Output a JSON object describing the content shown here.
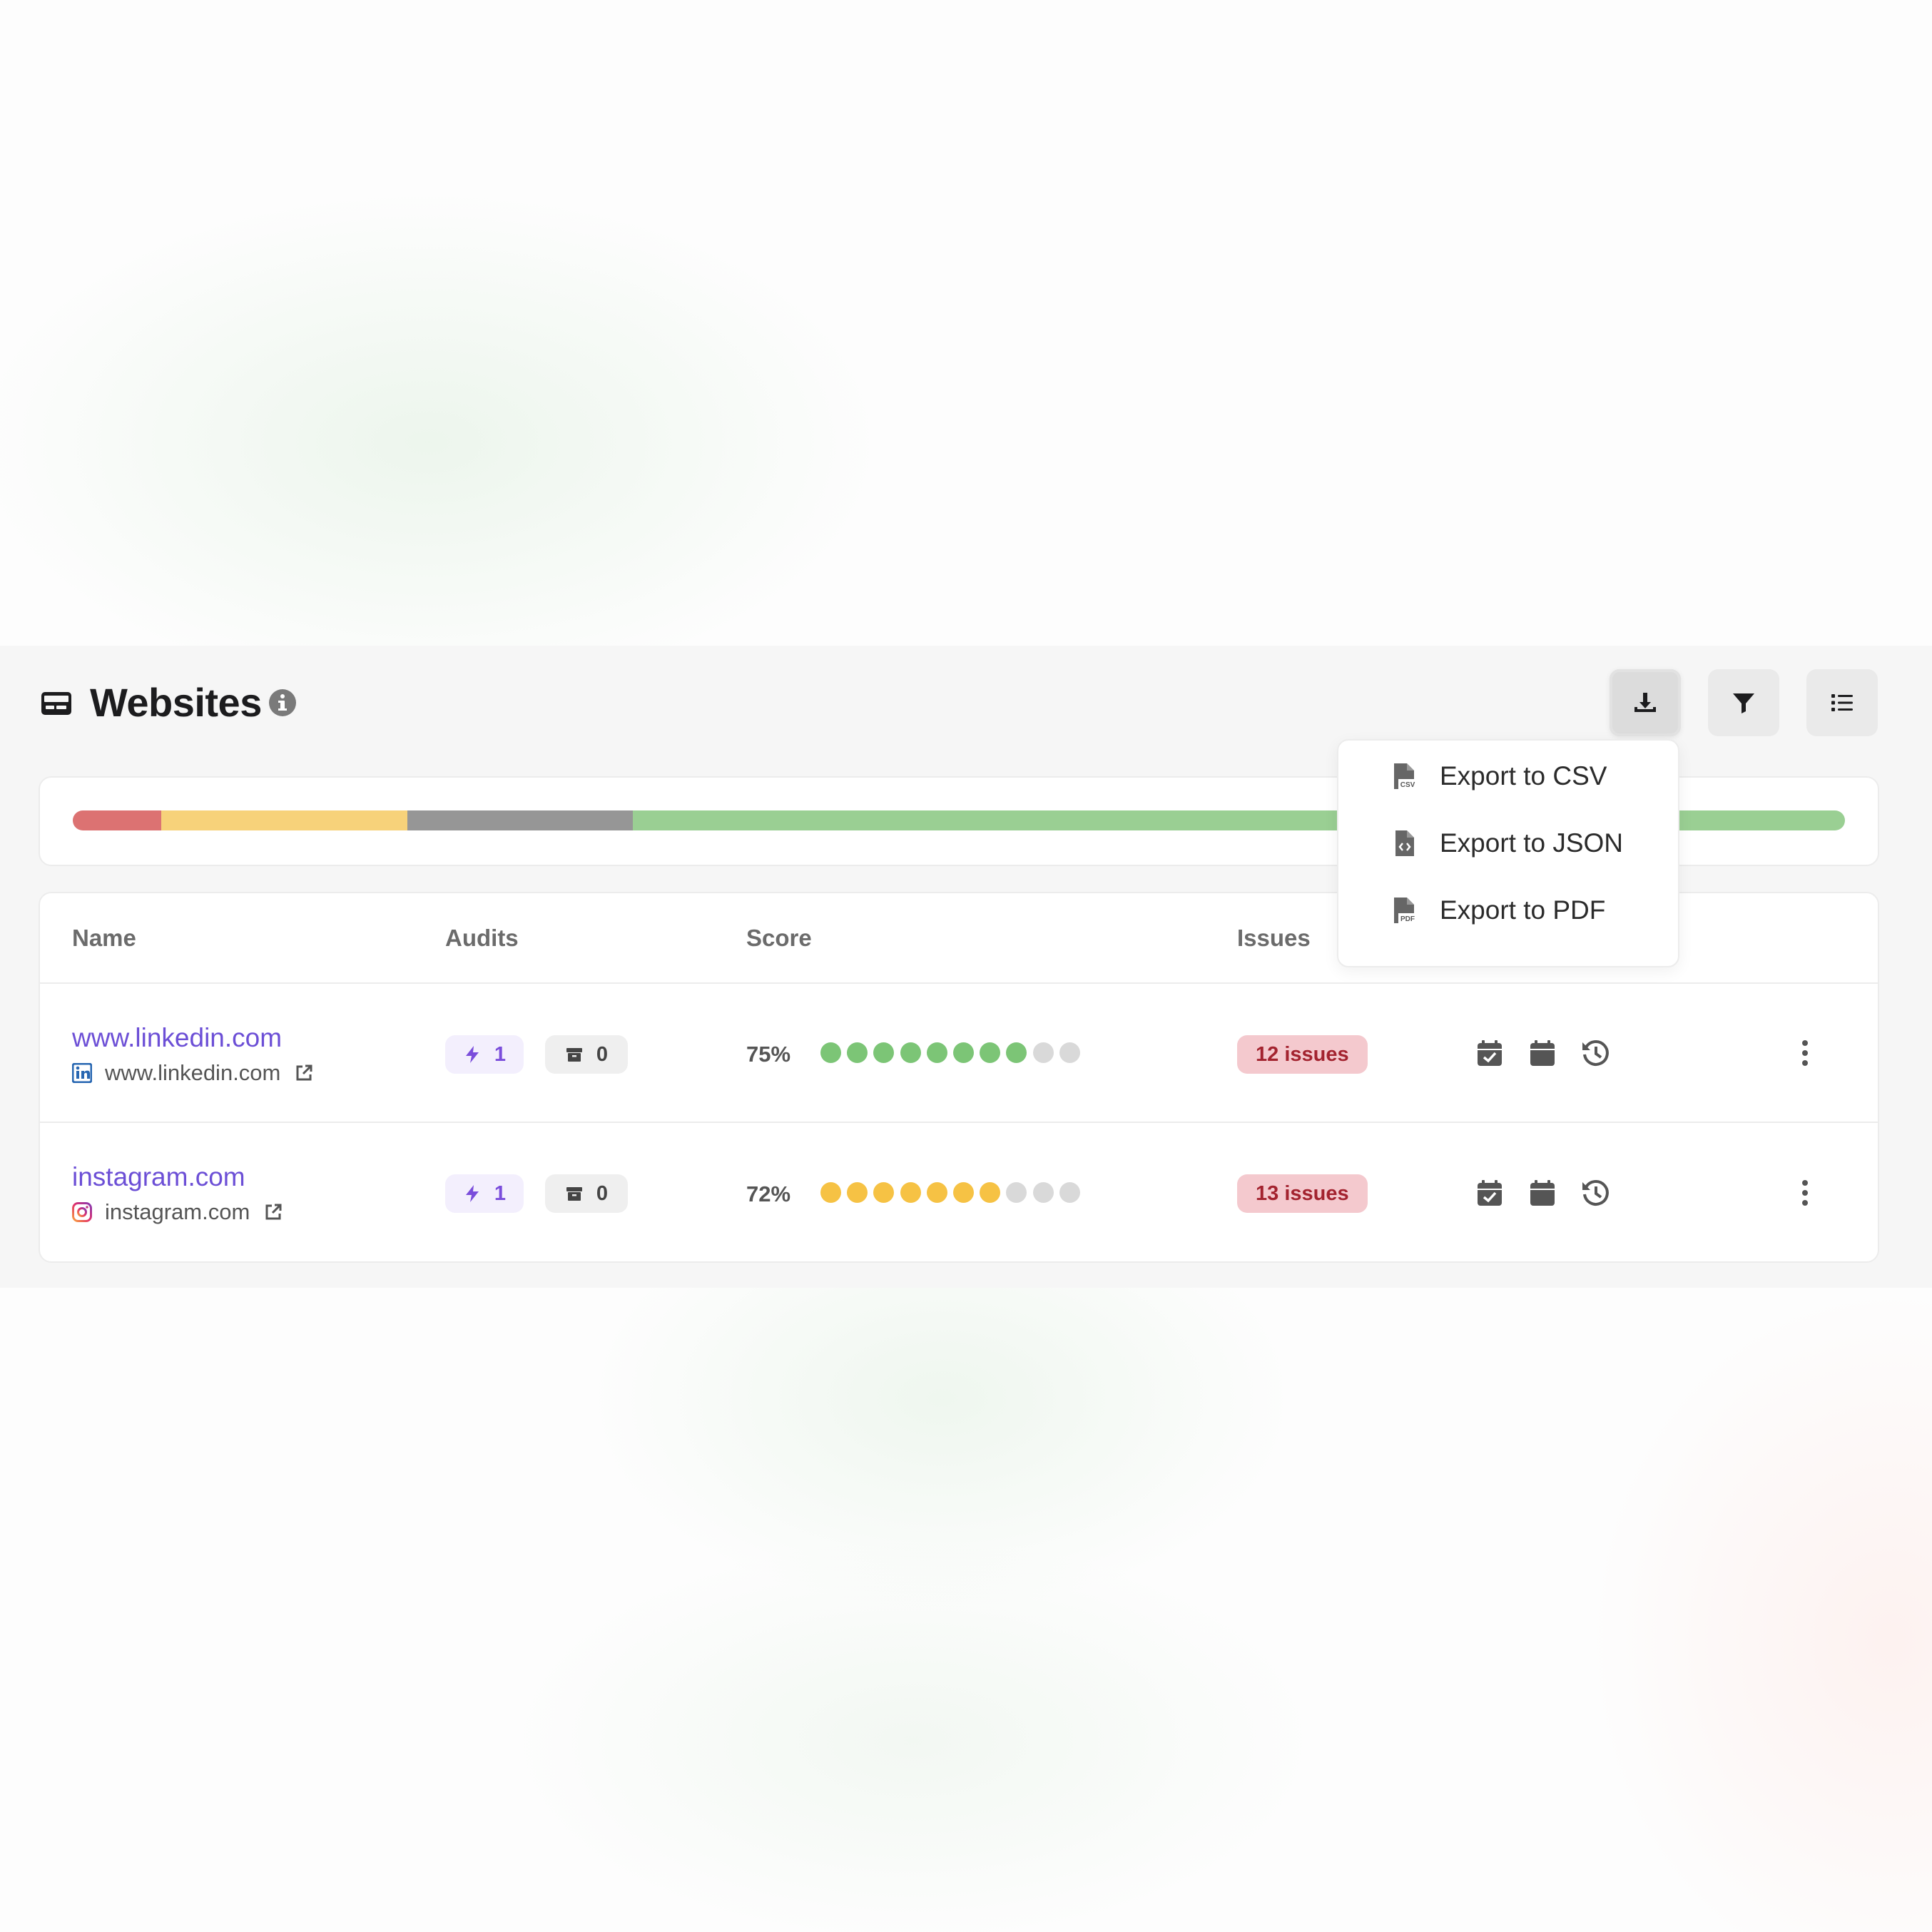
{
  "header": {
    "title": "Websites",
    "icon": "id-card-icon",
    "info_icon": "info-icon",
    "buttons": [
      {
        "name": "export-button",
        "icon": "download-icon",
        "active": true
      },
      {
        "name": "filter-button",
        "icon": "filter-icon",
        "active": false
      },
      {
        "name": "columns-button",
        "icon": "list-icon",
        "active": false
      }
    ]
  },
  "export_menu": {
    "items": [
      {
        "label": "Export to CSV",
        "icon": "csv-file-icon"
      },
      {
        "label": "Export to JSON",
        "icon": "code-file-icon"
      },
      {
        "label": "Export to PDF",
        "icon": "pdf-file-icon"
      }
    ]
  },
  "score_distribution": {
    "segments": [
      {
        "color": "#dc7272",
        "fraction": 0.05
      },
      {
        "color": "#f7d27a",
        "fraction": 0.139
      },
      {
        "color": "#969696",
        "fraction": 0.127
      },
      {
        "color": "#9acf93",
        "fraction": 0.684
      }
    ]
  },
  "table": {
    "columns": [
      "Name",
      "Audits",
      "Score",
      "Issues"
    ],
    "rows": [
      {
        "name": "www.linkedin.com",
        "domain": "www.linkedin.com",
        "favicon": "linkedin-icon",
        "audits_runs": "1",
        "audits_archived": "0",
        "score": "75%",
        "score_dots_filled": 8,
        "score_dots_total": 10,
        "score_color": "#7cc576",
        "issues": "12 issues"
      },
      {
        "name": "instagram.com",
        "domain": "instagram.com",
        "favicon": "instagram-icon",
        "audits_runs": "1",
        "audits_archived": "0",
        "score": "72%",
        "score_dots_filled": 7,
        "score_dots_total": 10,
        "score_color": "#f6c244",
        "issues": "13 issues"
      }
    ]
  },
  "colors": {
    "accent": "#6c4fd6",
    "issues_badge_bg": "#f4c9ce",
    "issues_badge_text": "#a3232f",
    "empty_dot": "#d9d9d9"
  }
}
